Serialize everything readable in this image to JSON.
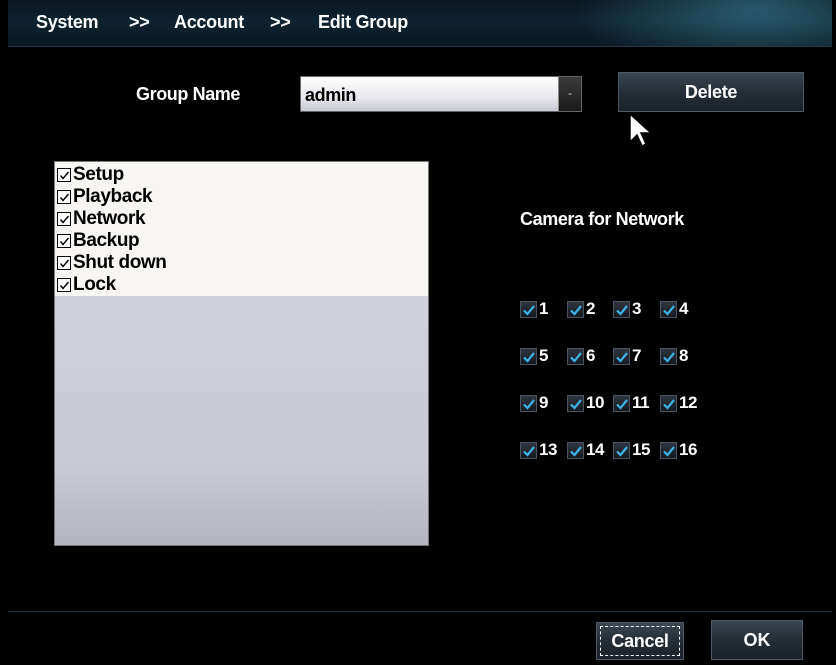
{
  "breadcrumb": {
    "items": [
      "System",
      "Account",
      "Edit Group"
    ],
    "separator": ">>"
  },
  "group": {
    "label": "Group Name",
    "selected": "admin",
    "dropdown_arrow": "-"
  },
  "buttons": {
    "delete": "Delete",
    "cancel": "Cancel",
    "ok": "OK"
  },
  "permissions": [
    {
      "label": "Setup",
      "checked": true
    },
    {
      "label": "Playback",
      "checked": true
    },
    {
      "label": "Network",
      "checked": true
    },
    {
      "label": "Backup",
      "checked": true
    },
    {
      "label": "Shut down",
      "checked": true
    },
    {
      "label": "Lock",
      "checked": true
    }
  ],
  "camera": {
    "title": "Camera for Network",
    "channels": [
      [
        "1",
        "2",
        "3",
        "4"
      ],
      [
        "5",
        "6",
        "7",
        "8"
      ],
      [
        "9",
        "10",
        "11",
        "12"
      ],
      [
        "13",
        "14",
        "15",
        "16"
      ]
    ],
    "check_color": "#3fb3e6"
  },
  "icons": {
    "cursor": "mouse-pointer-icon",
    "checkbox": "checkbox-checked-icon"
  }
}
